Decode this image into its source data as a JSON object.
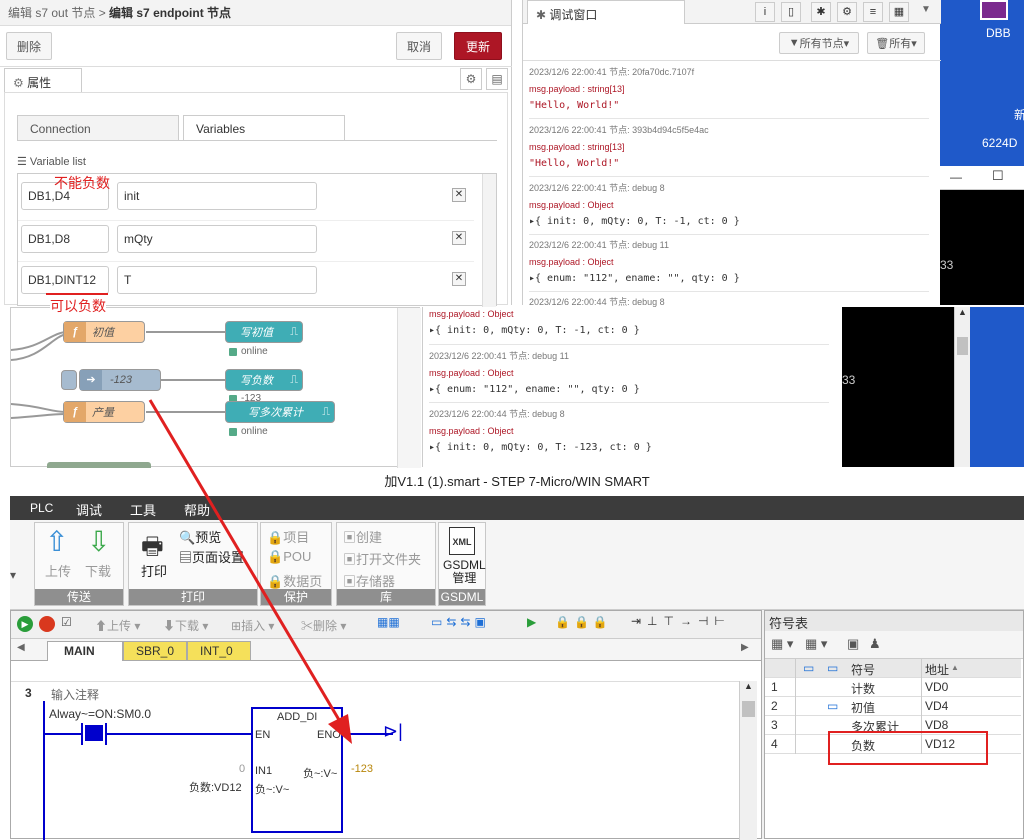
{
  "node_editor": {
    "breadcrumb_parent": "编辑 s7 out 节点 >",
    "breadcrumb_current": "编辑 s7 endpoint 节点",
    "delete_label": "删除",
    "cancel_label": "取消",
    "update_label": "更新",
    "properties_tab": "属性",
    "tabs": [
      "Connection",
      "Variables"
    ],
    "variable_list_label": "Variable list",
    "variables": [
      {
        "address": "DB1,D4",
        "name": "init"
      },
      {
        "address": "DB1,D8",
        "name": "mQty"
      },
      {
        "address": "DB1,DINT12",
        "name": "T"
      }
    ],
    "annotation_no_negative": "不能负数",
    "annotation_negative_ok": "可以负数"
  },
  "debug_window": {
    "title": "调试窗口",
    "filter_nodes": "所有节点",
    "filter_all": "所有",
    "messages": [
      {
        "meta": "2023/12/6 22:00:41   节点: 20fa70dc.7107f",
        "type": "msg.payload : string[13]",
        "value": "\"Hello, World!\""
      },
      {
        "meta": "2023/12/6 22:00:41   节点: 393b4d94c5f5e4ac",
        "type": "msg.payload : string[13]",
        "value": "\"Hello, World!\""
      },
      {
        "meta": "2023/12/6 22:00:41   节点: debug 8",
        "type": "msg.payload : Object",
        "value": "▸{ init: 0, mQty: 0, T: -1, ct: 0 }"
      },
      {
        "meta": "2023/12/6 22:00:41   节点: debug 11",
        "type": "msg.payload : Object",
        "value": "▸{ enum: \"112\", ename: \"\", qty: 0 }"
      },
      {
        "meta": "2023/12/6 22:00:44   节点: debug 8",
        "type": "",
        "value": ""
      }
    ]
  },
  "debug_window_2": {
    "messages": [
      {
        "meta": "",
        "type": "msg.payload : Object",
        "value": "▸{ init: 0, mQty: 0, T: -1, ct: 0 }"
      },
      {
        "meta": "2023/12/6 22:00:41   节点: debug 11",
        "type": "msg.payload : Object",
        "value": "▸{ enum: \"112\", ename: \"\", qty: 0 }"
      },
      {
        "meta": "2023/12/6 22:00:44   节点: debug 8",
        "type": "msg.payload : Object",
        "value": "▸{ init: 0, mQty: 0, T: -123, ct: 0 }"
      }
    ]
  },
  "flow": {
    "node_init": "初值",
    "node_write_init": "写初值",
    "node_inject": "-123",
    "node_write_neg": "写负数",
    "node_qty": "产量",
    "node_write_multi": "写多次累计",
    "status_online_1": "online",
    "status_inject": "-123",
    "status_online_2": "online"
  },
  "desktop": {
    "dbb_label": "DBB",
    "num_6224": "6224D",
    "char_new": "新",
    "num_33_a": "33",
    "num_33_b": "33"
  },
  "step7": {
    "title": "加V1.1 (1).smart - STEP 7-Micro/WIN SMART",
    "menu": [
      "PLC",
      "调试",
      "工具",
      "帮助"
    ],
    "ribbon": {
      "upload": "上传",
      "download": "下载",
      "group_transfer": "传送",
      "print": "打印",
      "preview": "预览",
      "page_setup": "页面设置",
      "group_print": "打印",
      "project": "项目",
      "pou": "POU",
      "data_page": "数据页",
      "group_protect": "保护",
      "create": "创建",
      "open_folder": "打开文件夹",
      "memory": "存储器",
      "group_library": "库",
      "gsdml_line1": "GSDML",
      "gsdml_line2": "管理",
      "group_gsdml": "GSDML"
    },
    "toolbar": {
      "upload": "上传",
      "download": "下载",
      "insert": "插入",
      "delete": "删除"
    },
    "tabs": [
      "MAIN",
      "SBR_0",
      "INT_0"
    ],
    "network_no": "3",
    "network_comment": "输入注释",
    "contact_label": "Alway~=ON:SM0.0",
    "block_name": "ADD_DI",
    "pin_en": "EN",
    "pin_eno": "ENO",
    "pin_in1": "IN1",
    "pin_in1_value": "0",
    "pin_in2": "负~:V~",
    "pin_in2_label": "负数:VD12",
    "pin_out": "负~:V~",
    "pin_out_value": "-123",
    "symbol_table": {
      "title": "符号表",
      "headers": [
        "符号",
        "地址"
      ],
      "rows": [
        {
          "idx": "1",
          "symbol": "计数",
          "addr": "VD0"
        },
        {
          "idx": "2",
          "symbol": "初值",
          "addr": "VD4"
        },
        {
          "idx": "3",
          "symbol": "多次累计",
          "addr": "VD8"
        },
        {
          "idx": "4",
          "symbol": "负数",
          "addr": "VD12"
        }
      ]
    }
  },
  "colors": {
    "accent": "#ad1625",
    "annotation_red": "#e02020",
    "step7_blue": "#0000cc"
  }
}
